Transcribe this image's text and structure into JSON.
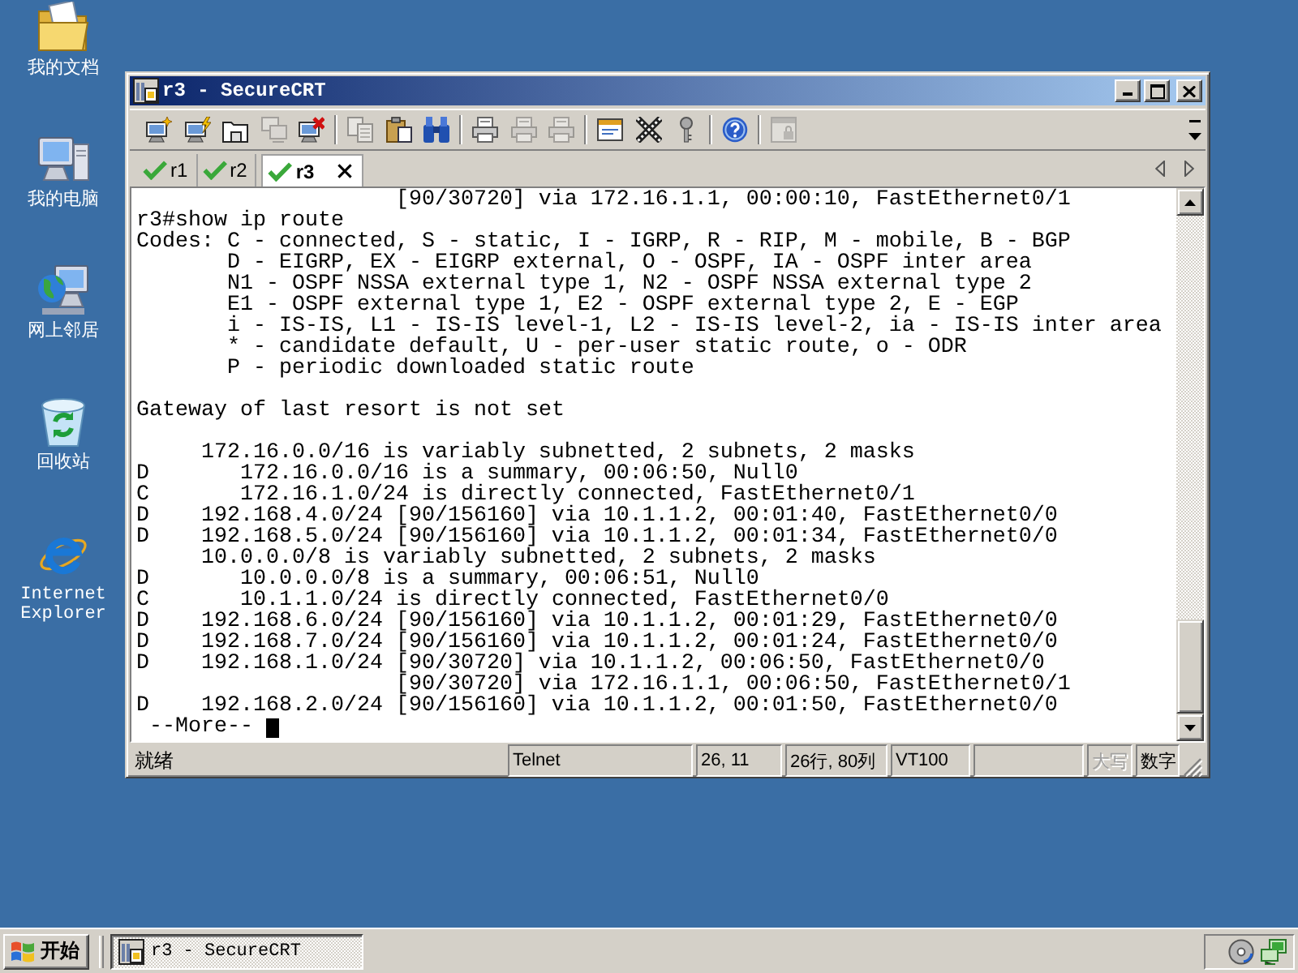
{
  "desktop_icons": [
    {
      "kind": "folder",
      "label": "我的文档"
    },
    {
      "kind": "computer",
      "label": "我的电脑"
    },
    {
      "kind": "network",
      "label": "网上邻居"
    },
    {
      "kind": "recycle",
      "label": "回收站"
    },
    {
      "kind": "browser",
      "label": "Internet Explorer"
    }
  ],
  "window": {
    "title": "r3 - SecureCRT"
  },
  "toolbar_groups": [
    {
      "buttons": [
        {
          "kind": "connect",
          "disabled": false
        },
        {
          "kind": "lightning",
          "disabled": false
        },
        {
          "kind": "folder",
          "disabled": false
        },
        {
          "kind": "clone",
          "disabled": true
        },
        {
          "kind": "disconnect",
          "disabled": false
        }
      ]
    },
    {
      "buttons": [
        {
          "kind": "copy",
          "disabled": true
        },
        {
          "kind": "paste",
          "disabled": false
        },
        {
          "kind": "find",
          "disabled": false
        }
      ]
    },
    {
      "buttons": [
        {
          "kind": "print",
          "disabled": false
        },
        {
          "kind": "print",
          "disabled": true
        },
        {
          "kind": "print",
          "disabled": true
        }
      ]
    },
    {
      "buttons": [
        {
          "kind": "options",
          "disabled": false
        },
        {
          "kind": "keymap",
          "disabled": false
        },
        {
          "kind": "key",
          "disabled": false
        }
      ]
    },
    {
      "buttons": [
        {
          "kind": "help",
          "disabled": false
        }
      ]
    },
    {
      "buttons": [
        {
          "kind": "lock",
          "disabled": true
        }
      ]
    }
  ],
  "tabs": [
    {
      "label": "r1",
      "selected": false
    },
    {
      "label": "r2",
      "selected": false
    },
    {
      "label": "r3",
      "selected": true
    }
  ],
  "terminal": {
    "lines": [
      {
        "kind": "continuation",
        "text": "[90/30720] via 172.16.1.1, 00:00:10, FastEthernet0/1"
      },
      {
        "kind": "plain",
        "text": "r3#show ip route"
      },
      {
        "kind": "plain",
        "text": "Codes: C - connected, S - static, I - IGRP, R - RIP, M - mobile, B - BGP"
      },
      {
        "kind": "legend",
        "text": "D - EIGRP, EX - EIGRP external, O - OSPF, IA - OSPF inter area"
      },
      {
        "kind": "legend",
        "text": "N1 - OSPF NSSA external type 1, N2 - OSPF NSSA external type 2"
      },
      {
        "kind": "legend",
        "text": "E1 - OSPF external type 1, E2 - OSPF external type 2, E - EGP"
      },
      {
        "kind": "legend",
        "text": "i - IS-IS, L1 - IS-IS level-1, L2 - IS-IS level-2, ia - IS-IS inter area"
      },
      {
        "kind": "legend",
        "text": "* - candidate default, U - per-user static route, o - ODR"
      },
      {
        "kind": "legend",
        "text": "P - periodic downloaded static route"
      },
      {
        "kind": "blank"
      },
      {
        "kind": "plain",
        "text": "Gateway of last resort is not set"
      },
      {
        "kind": "blank"
      },
      {
        "kind": "summary",
        "text": "172.16.0.0/16 is variably subnetted, 2 subnets, 2 masks"
      },
      {
        "kind": "subnet",
        "code": "D",
        "text": "172.16.0.0/16 is a summary, 00:06:50, Null0"
      },
      {
        "kind": "subnet",
        "code": "C",
        "text": "172.16.1.0/24 is directly connected, FastEthernet0/1"
      },
      {
        "kind": "route",
        "code": "D",
        "text": "192.168.4.0/24 [90/156160] via 10.1.1.2, 00:01:40, FastEthernet0/0"
      },
      {
        "kind": "route",
        "code": "D",
        "text": "192.168.5.0/24 [90/156160] via 10.1.1.2, 00:01:34, FastEthernet0/0"
      },
      {
        "kind": "summary",
        "text": "10.0.0.0/8 is variably subnetted, 2 subnets, 2 masks"
      },
      {
        "kind": "subnet",
        "code": "D",
        "text": "10.0.0.0/8 is a summary, 00:06:51, Null0"
      },
      {
        "kind": "subnet",
        "code": "C",
        "text": "10.1.1.0/24 is directly connected, FastEthernet0/0"
      },
      {
        "kind": "route",
        "code": "D",
        "text": "192.168.6.0/24 [90/156160] via 10.1.1.2, 00:01:29, FastEthernet0/0"
      },
      {
        "kind": "route",
        "code": "D",
        "text": "192.168.7.0/24 [90/156160] via 10.1.1.2, 00:01:24, FastEthernet0/0"
      },
      {
        "kind": "route",
        "code": "D",
        "text": "192.168.1.0/24 [90/30720] via 10.1.1.2, 00:06:50, FastEthernet0/0"
      },
      {
        "kind": "continuation",
        "text": "[90/30720] via 172.16.1.1, 00:06:50, FastEthernet0/1"
      },
      {
        "kind": "route",
        "code": "D",
        "text": "192.168.2.0/24 [90/156160] via 10.1.1.2, 00:01:50, FastEthernet0/0"
      },
      {
        "kind": "pager",
        "text": "--More--"
      }
    ]
  },
  "status_bar": {
    "message": "就绪",
    "panels": [
      "Telnet",
      "26, 11",
      "26行, 80列",
      "VT100"
    ],
    "indicators": [
      {
        "label": "大写",
        "on": false
      },
      {
        "label": "数字",
        "on": true
      }
    ]
  },
  "taskbar": {
    "start_button": "开始",
    "tasks": [
      {
        "label": "r3 - SecureCRT",
        "selected": true
      }
    ]
  }
}
